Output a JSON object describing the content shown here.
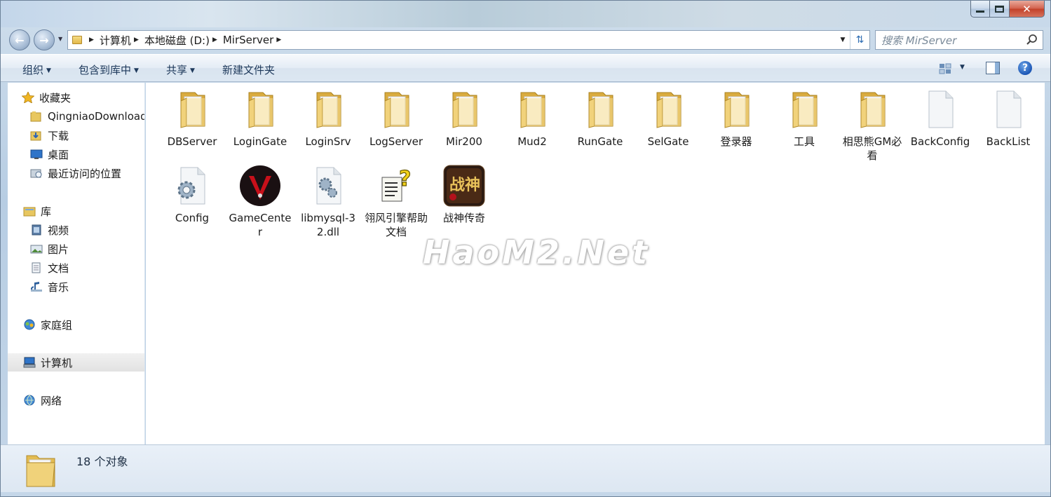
{
  "window": {
    "controls": {
      "minimize": "minimize-icon",
      "maximize": "maximize-icon",
      "close": "✕"
    }
  },
  "address_bar": {
    "breadcrumbs": [
      "计算机",
      "本地磁盘 (D:)",
      "MirServer"
    ]
  },
  "search": {
    "placeholder": "搜索 MirServer"
  },
  "toolbar": {
    "organize": "组织",
    "include_in_library": "包含到库中",
    "share": "共享",
    "new_folder": "新建文件夹",
    "help": "?"
  },
  "sidebar": {
    "favorites": {
      "label": "收藏夹",
      "items": [
        "QingniaoDownload",
        "下载",
        "桌面",
        "最近访问的位置"
      ]
    },
    "libraries": {
      "label": "库",
      "items": [
        "视频",
        "图片",
        "文档",
        "音乐"
      ]
    },
    "homegroup": "家庭组",
    "computer": "计算机",
    "network": "网络"
  },
  "files": [
    {
      "name": "DBServer",
      "type": "folder"
    },
    {
      "name": "LoginGate",
      "type": "folder"
    },
    {
      "name": "LoginSrv",
      "type": "folder"
    },
    {
      "name": "LogServer",
      "type": "folder"
    },
    {
      "name": "Mir200",
      "type": "folder"
    },
    {
      "name": "Mud2",
      "type": "folder"
    },
    {
      "name": "RunGate",
      "type": "folder"
    },
    {
      "name": "SelGate",
      "type": "folder"
    },
    {
      "name": "登录器",
      "type": "folder"
    },
    {
      "name": "工具",
      "type": "folder"
    },
    {
      "name": "相思熊GM必看",
      "type": "folder"
    },
    {
      "name": "BackConfig",
      "type": "file"
    },
    {
      "name": "BackList",
      "type": "file"
    },
    {
      "name": "Config",
      "type": "config"
    },
    {
      "name": "GameCenter",
      "type": "app"
    },
    {
      "name": "libmysql-32.dll",
      "type": "dll"
    },
    {
      "name": "翎风引擎帮助文档",
      "type": "help"
    },
    {
      "name": "战神传奇",
      "type": "game"
    }
  ],
  "watermark": "HaoM2.Net",
  "status": {
    "count_text": "18 个对象"
  },
  "colors": {
    "folder": "#e8c760",
    "accent": "#1e395b",
    "selected_nav": "#e4e4e4",
    "gamecenter": "#c8101a"
  }
}
